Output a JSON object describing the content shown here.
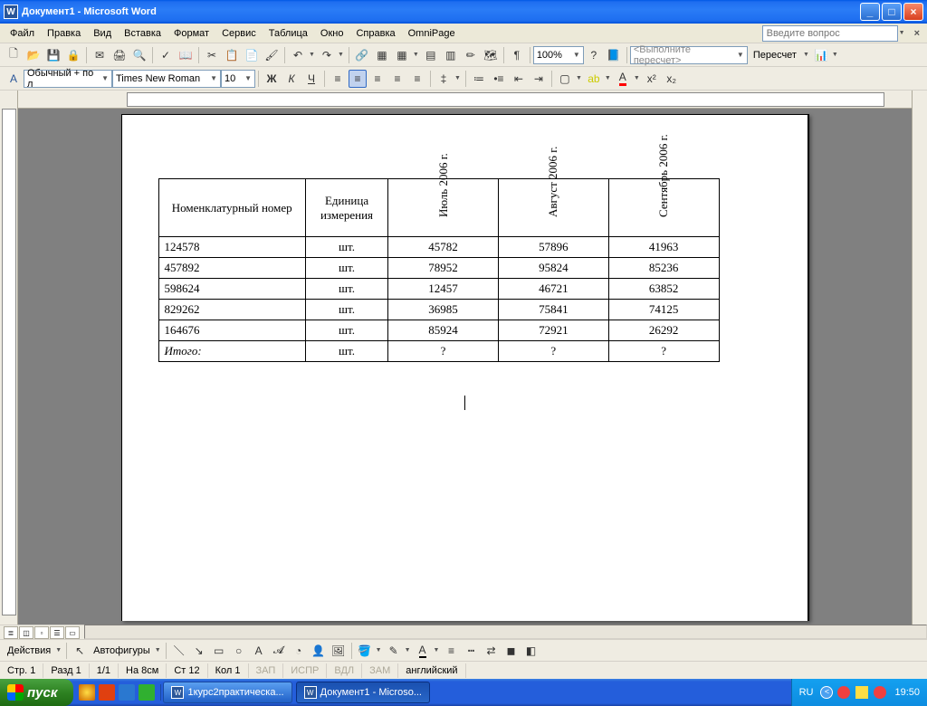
{
  "titlebar": {
    "title": "Документ1 - Microsoft Word"
  },
  "menubar": {
    "items": [
      "Файл",
      "Правка",
      "Вид",
      "Вставка",
      "Формат",
      "Сервис",
      "Таблица",
      "Окно",
      "Справка",
      "OmniPage"
    ],
    "help_placeholder": "Введите вопрос"
  },
  "toolbar1": {
    "zoom": "100%",
    "recalc_hint": "<Выполните пересчет>",
    "recalc_btn": "Пересчет"
  },
  "toolbar2": {
    "style": "Обычный + по л",
    "font": "Times New Roman",
    "size": "10",
    "bold": "Ж",
    "italic": "К",
    "underline": "Ч"
  },
  "table": {
    "headers": {
      "nomenclature": "Номенклатурный номер",
      "unit": "Единица измерения",
      "jul": "Июль 2006 г.",
      "aug": "Август 2006 г.",
      "sep": "Сентябрь 2006 г."
    },
    "rows": [
      {
        "num": "124578",
        "unit": "шт.",
        "jul": "45782",
        "aug": "57896",
        "sep": "41963"
      },
      {
        "num": "457892",
        "unit": "шт.",
        "jul": "78952",
        "aug": "95824",
        "sep": "85236"
      },
      {
        "num": "598624",
        "unit": "шт.",
        "jul": "12457",
        "aug": "46721",
        "sep": "63852"
      },
      {
        "num": "829262",
        "unit": "шт.",
        "jul": "36985",
        "aug": "75841",
        "sep": "74125"
      },
      {
        "num": "164676",
        "unit": "шт.",
        "jul": "85924",
        "aug": "72921",
        "sep": "26292"
      }
    ],
    "total": {
      "label": "Итого:",
      "unit": "шт.",
      "jul": "?",
      "aug": "?",
      "sep": "?"
    }
  },
  "drawbar": {
    "actions": "Действия",
    "autoshapes": "Автофигуры"
  },
  "statusbar": {
    "page": "Стр. 1",
    "section": "Разд 1",
    "pages": "1/1",
    "at": "На 8см",
    "line": "Ст 12",
    "col": "Кол 1",
    "rec": "ЗАП",
    "trk": "ИСПР",
    "ext": "ВДЛ",
    "ovr": "ЗАМ",
    "lang": "английский"
  },
  "taskbar": {
    "start": "пуск",
    "tasks": [
      {
        "label": "1курс2практическа..."
      },
      {
        "label": "Документ1 - Microso..."
      }
    ],
    "lang": "RU",
    "clock": "19:50"
  }
}
